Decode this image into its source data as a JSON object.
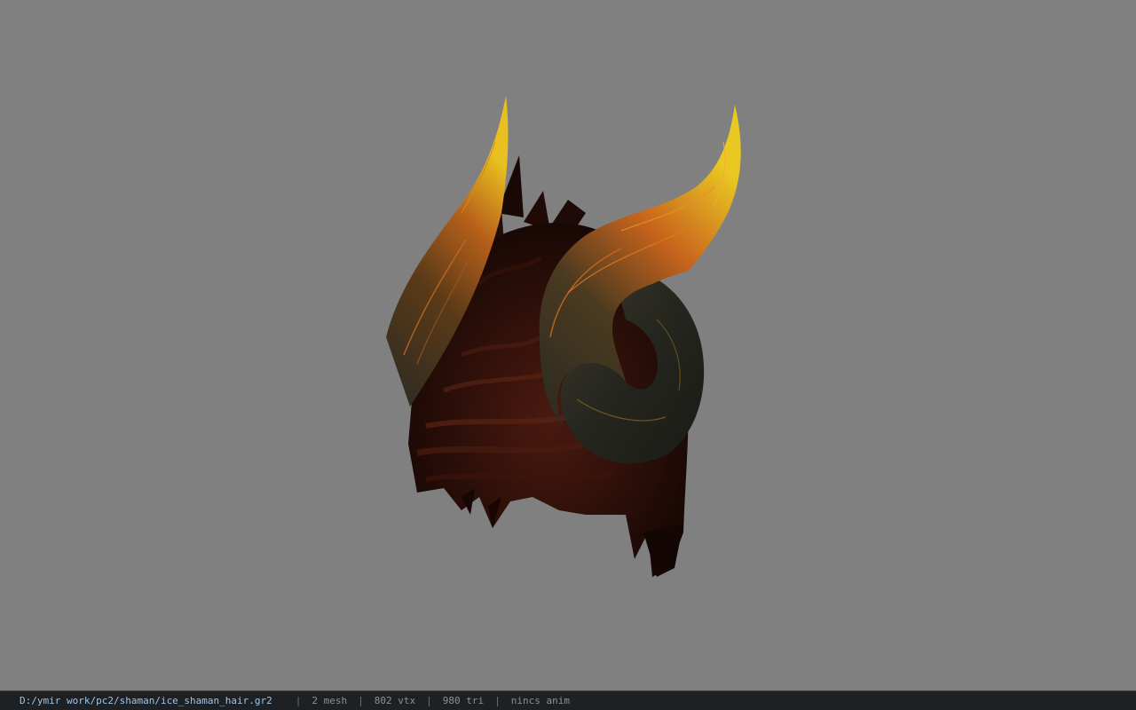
{
  "viewport": {
    "background": "#808080",
    "model_name": "ice_shaman_hair"
  },
  "statusbar": {
    "file_path": "D:/ymir work/pc2/shaman/ice_shaman_hair.gr2",
    "separator": "|",
    "mesh": "2 mesh",
    "vertices": "802 vtx",
    "triangles": "980 tri",
    "anim": "nincs anim"
  },
  "colors": {
    "horn_tip": "#e8c020",
    "horn_mid": "#c8641c",
    "horn_dark": "#2a2a22",
    "hair_dark": "#1e0a06",
    "hair_mid": "#4a1a10"
  }
}
